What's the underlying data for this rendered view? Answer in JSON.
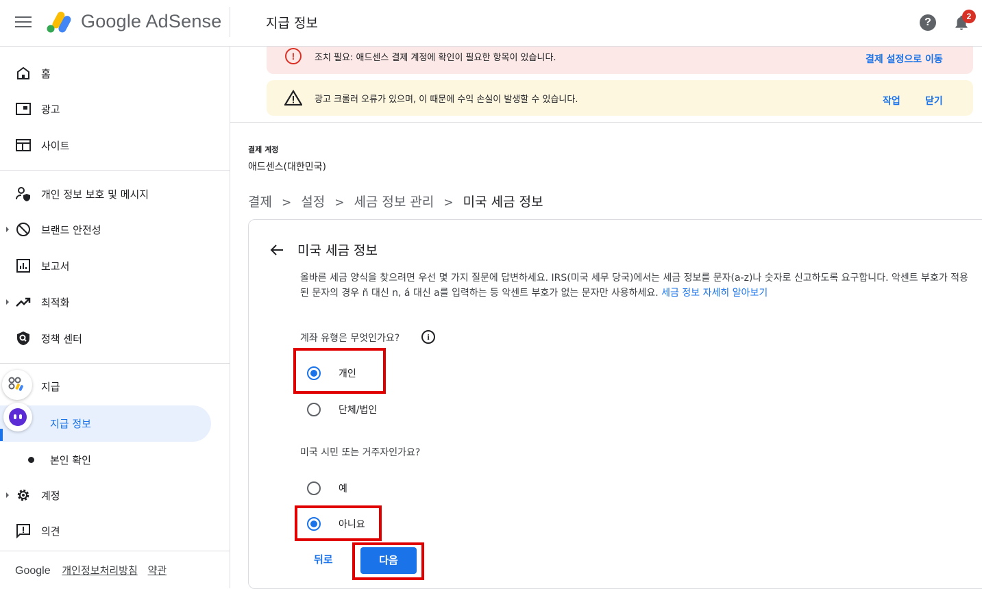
{
  "app": {
    "logo_text": "Google AdSense",
    "page_title": "지급 정보",
    "notification_count": "2"
  },
  "sidebar": {
    "items": [
      {
        "label": "홈",
        "icon": "home-icon"
      },
      {
        "label": "광고",
        "icon": "ads-icon"
      },
      {
        "label": "사이트",
        "icon": "sites-icon"
      },
      {
        "label": "개인 정보 보호 및 메시지",
        "icon": "privacy-icon"
      },
      {
        "label": "브랜드 안전성",
        "icon": "block-icon"
      },
      {
        "label": "보고서",
        "icon": "reports-icon"
      },
      {
        "label": "최적화",
        "icon": "trending-icon"
      },
      {
        "label": "정책 센터",
        "icon": "policy-shield-icon"
      },
      {
        "label": "지급",
        "icon": "payments-icon"
      },
      {
        "label": "지급 정보",
        "icon": ""
      },
      {
        "label": "본인 확인",
        "icon": ""
      },
      {
        "label": "계정",
        "icon": "gear-icon"
      },
      {
        "label": "의견",
        "icon": "feedback-icon"
      }
    ],
    "footer": {
      "brand": "Google",
      "privacy": "개인정보처리방침",
      "terms": "약관"
    }
  },
  "alerts": {
    "error": {
      "text": "조치 필요: 애드센스 결제 계정에 확인이 필요한 항목이 있습니다.",
      "link": "결제 설정으로 이동"
    },
    "warning": {
      "text": "광고 크롤러 오류가 있으며, 이 때문에 수익 손실이 발생할 수 있습니다.",
      "action": "작업",
      "dismiss": "닫기"
    }
  },
  "billing": {
    "label": "결제 계정",
    "value": "애드센스(대한민국)"
  },
  "breadcrumb": [
    "결제",
    "설정",
    "세금 정보 관리",
    "미국 세금 정보"
  ],
  "card": {
    "title": "미국 세금 정보",
    "description": "올바른 세금 양식을 찾으려면 우선 몇 가지 질문에 답변하세요. IRS(미국 세무 당국)에서는 세금 정보를 문자(a-z)나 숫자로 신고하도록 요구합니다. 악센트 부호가 적용된 문자의 경우 ñ 대신 n, á 대신 a를 입력하는 등 악센트 부호가 없는 문자만 사용하세요.",
    "learn_more": "세금 정보 자세히 알아보기",
    "q1": {
      "label": "계좌 유형은 무엇인가요?",
      "options": [
        "개인",
        "단체/법인"
      ],
      "selected": "개인"
    },
    "q2": {
      "label": "미국 시민 또는 거주자인가요?",
      "options": [
        "예",
        "아니요"
      ],
      "selected": "아니요"
    },
    "back_button": "뒤로",
    "next_button": "다음"
  },
  "colors": {
    "accent": "#1a73e8",
    "highlight": "#e10000",
    "error_bg": "#fce8e6",
    "warning_bg": "#fef7e0"
  }
}
